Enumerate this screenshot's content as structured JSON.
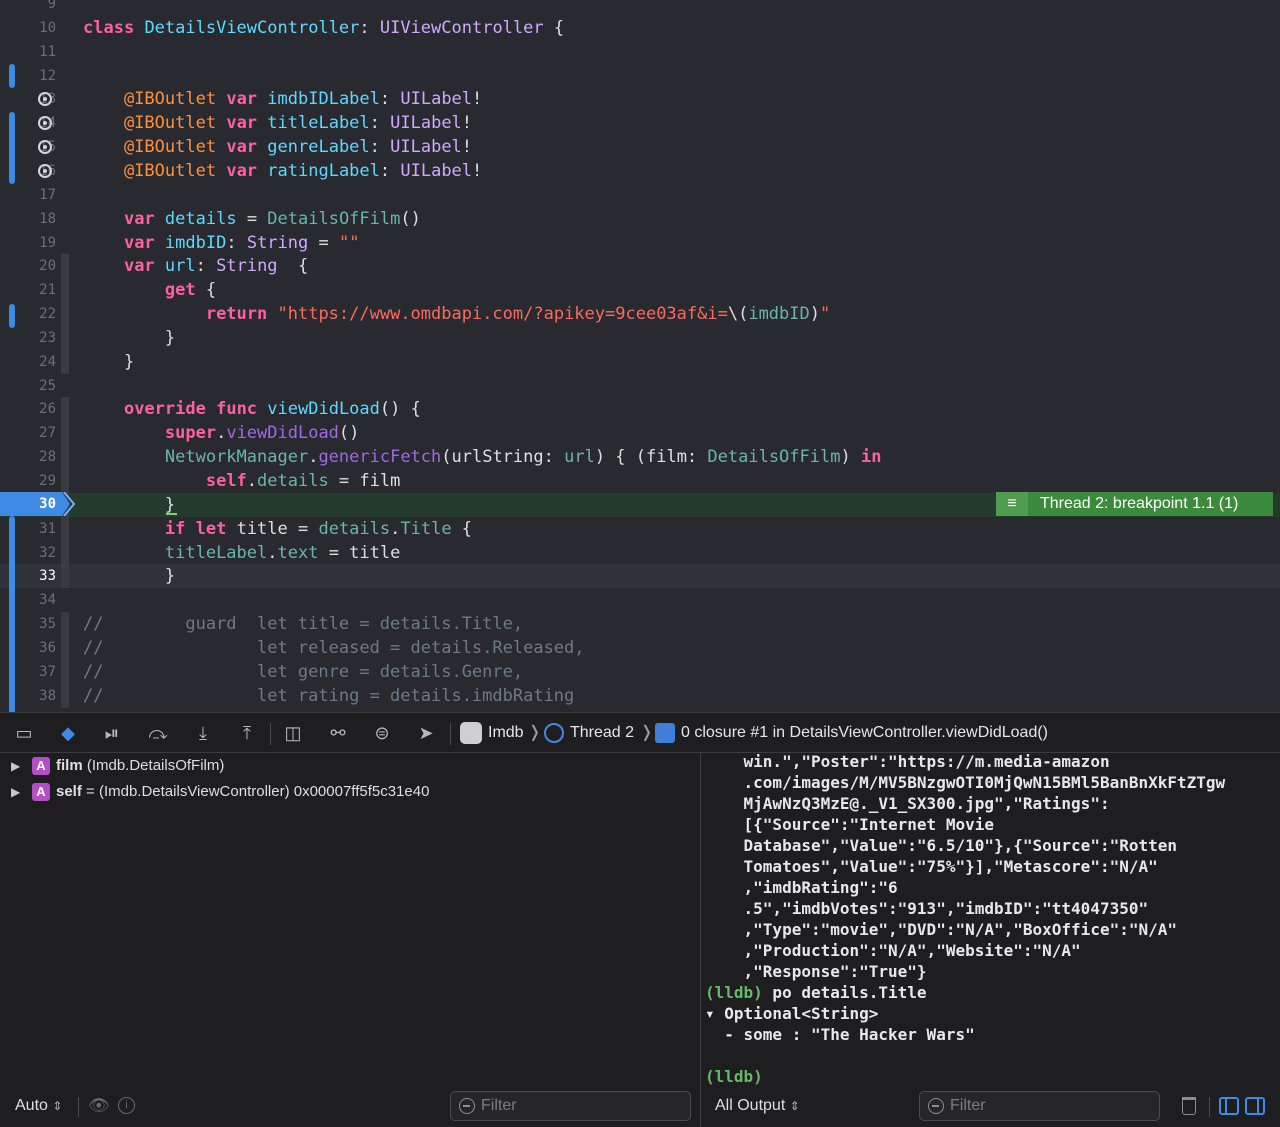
{
  "editor": {
    "lines": [
      {
        "num": "9",
        "tokens": []
      },
      {
        "num": "10",
        "tokens": [
          [
            "kw",
            "class"
          ],
          [
            "",
            " "
          ],
          [
            "tyd",
            "DetailsViewController"
          ],
          [
            "",
            ": "
          ],
          [
            "ty",
            "UIViewController"
          ],
          [
            "",
            " {"
          ]
        ]
      },
      {
        "num": "11",
        "tokens": []
      },
      {
        "num": "12",
        "tokens": []
      },
      {
        "num": "13",
        "tokens": [
          [
            "",
            "    "
          ],
          [
            "attr",
            "@IBOutlet"
          ],
          [
            "",
            " "
          ],
          [
            "kw",
            "var"
          ],
          [
            "",
            " "
          ],
          [
            "tyd",
            "imdbIDLabel"
          ],
          [
            "",
            ": "
          ],
          [
            "ty",
            "UILabel"
          ],
          [
            "",
            "!"
          ]
        ]
      },
      {
        "num": "14",
        "tokens": [
          [
            "",
            "    "
          ],
          [
            "attr",
            "@IBOutlet"
          ],
          [
            "",
            " "
          ],
          [
            "kw",
            "var"
          ],
          [
            "",
            " "
          ],
          [
            "tyd",
            "titleLabel"
          ],
          [
            "",
            ": "
          ],
          [
            "ty",
            "UILabel"
          ],
          [
            "",
            "!"
          ]
        ]
      },
      {
        "num": "15",
        "tokens": [
          [
            "",
            "    "
          ],
          [
            "attr",
            "@IBOutlet"
          ],
          [
            "",
            " "
          ],
          [
            "kw",
            "var"
          ],
          [
            "",
            " "
          ],
          [
            "tyd",
            "genreLabel"
          ],
          [
            "",
            ": "
          ],
          [
            "ty",
            "UILabel"
          ],
          [
            "",
            "!"
          ]
        ]
      },
      {
        "num": "16",
        "tokens": [
          [
            "",
            "    "
          ],
          [
            "attr",
            "@IBOutlet"
          ],
          [
            "",
            " "
          ],
          [
            "kw",
            "var"
          ],
          [
            "",
            " "
          ],
          [
            "tyd",
            "ratingLabel"
          ],
          [
            "",
            ": "
          ],
          [
            "ty",
            "UILabel"
          ],
          [
            "",
            "!"
          ]
        ]
      },
      {
        "num": "17",
        "tokens": []
      },
      {
        "num": "18",
        "tokens": [
          [
            "",
            "    "
          ],
          [
            "kw",
            "var"
          ],
          [
            "",
            " "
          ],
          [
            "tyd",
            "details"
          ],
          [
            "",
            " = "
          ],
          [
            "prop",
            "DetailsOfFilm"
          ],
          [
            "",
            "()"
          ]
        ]
      },
      {
        "num": "19",
        "tokens": [
          [
            "",
            "    "
          ],
          [
            "kw",
            "var"
          ],
          [
            "",
            " "
          ],
          [
            "tyd",
            "imdbID"
          ],
          [
            "",
            ": "
          ],
          [
            "ty",
            "String"
          ],
          [
            "",
            " = "
          ],
          [
            "str",
            "\"\""
          ]
        ]
      },
      {
        "num": "20",
        "tokens": [
          [
            "",
            "    "
          ],
          [
            "kw",
            "var"
          ],
          [
            "",
            " "
          ],
          [
            "tyd",
            "url"
          ],
          [
            "",
            ": "
          ],
          [
            "ty",
            "String"
          ],
          [
            "",
            "  {"
          ]
        ]
      },
      {
        "num": "21",
        "tokens": [
          [
            "",
            "        "
          ],
          [
            "kw",
            "get"
          ],
          [
            "",
            " {"
          ]
        ]
      },
      {
        "num": "22",
        "tokens": [
          [
            "",
            "            "
          ],
          [
            "kw",
            "return"
          ],
          [
            "",
            " "
          ],
          [
            "str",
            "\"https://www.omdbapi.com/?apikey=9cee03af&i="
          ],
          [
            "",
            "\\("
          ],
          [
            "prop",
            "imdbID"
          ],
          [
            "",
            ")"
          ],
          [
            "str",
            "\""
          ]
        ]
      },
      {
        "num": "23",
        "tokens": [
          [
            "",
            "        }"
          ]
        ]
      },
      {
        "num": "24",
        "tokens": [
          [
            "",
            "    }"
          ]
        ]
      },
      {
        "num": "25",
        "tokens": []
      },
      {
        "num": "26",
        "tokens": [
          [
            "",
            "    "
          ],
          [
            "kw",
            "override"
          ],
          [
            "",
            " "
          ],
          [
            "kw",
            "func"
          ],
          [
            "",
            " "
          ],
          [
            "tyd",
            "viewDidLoad"
          ],
          [
            "",
            "() {"
          ]
        ]
      },
      {
        "num": "27",
        "tokens": [
          [
            "",
            "        "
          ],
          [
            "kw",
            "super"
          ],
          [
            "",
            "."
          ],
          [
            "meth",
            "viewDidLoad"
          ],
          [
            "",
            "()"
          ]
        ]
      },
      {
        "num": "28",
        "tokens": [
          [
            "",
            "        "
          ],
          [
            "prop",
            "NetworkManager"
          ],
          [
            "",
            "."
          ],
          [
            "meth",
            "genericFetch"
          ],
          [
            "",
            "(urlString: "
          ],
          [
            "prop",
            "url"
          ],
          [
            "",
            ") { (film: "
          ],
          [
            "prop",
            "DetailsOfFilm"
          ],
          [
            "",
            ") "
          ],
          [
            "kw",
            "in"
          ]
        ]
      },
      {
        "num": "29",
        "tokens": [
          [
            "",
            "            "
          ],
          [
            "kw",
            "self"
          ],
          [
            "",
            "."
          ],
          [
            "prop",
            "details"
          ],
          [
            "",
            " = film"
          ]
        ]
      },
      {
        "num": "30",
        "tokens": [
          [
            "",
            "        }"
          ]
        ]
      },
      {
        "num": "31",
        "tokens": [
          [
            "",
            "        "
          ],
          [
            "kw",
            "if"
          ],
          [
            "",
            " "
          ],
          [
            "kw",
            "let"
          ],
          [
            "",
            " title = "
          ],
          [
            "prop",
            "details"
          ],
          [
            "",
            "."
          ],
          [
            "prop",
            "Title"
          ],
          [
            "",
            " {"
          ]
        ]
      },
      {
        "num": "32",
        "tokens": [
          [
            "",
            "        "
          ],
          [
            "prop",
            "titleLabel"
          ],
          [
            "",
            "."
          ],
          [
            "prop",
            "text"
          ],
          [
            "",
            " = title"
          ]
        ]
      },
      {
        "num": "33",
        "tokens": [
          [
            "",
            "        }"
          ]
        ]
      },
      {
        "num": "34",
        "tokens": []
      },
      {
        "num": "35",
        "tokens": [
          [
            "cmt",
            "//        guard  let title = details.Title,"
          ]
        ]
      },
      {
        "num": "36",
        "tokens": [
          [
            "cmt",
            "//               let released = details.Released,"
          ]
        ]
      },
      {
        "num": "37",
        "tokens": [
          [
            "cmt",
            "//               let genre = details.Genre,"
          ]
        ]
      },
      {
        "num": "38",
        "tokens": [
          [
            "cmt",
            "//               let rating = details.imdbRating"
          ]
        ]
      }
    ],
    "breakpoint_label": "Thread 2: breakpoint 1.1 (1)"
  },
  "debugbar": {
    "target": "Imdb",
    "thread": "Thread 2",
    "frame": "0 closure #1 in DetailsViewController.viewDidLoad()"
  },
  "variables": [
    {
      "name": "film",
      "detail": " (Imdb.DetailsOfFilm)"
    },
    {
      "name": "self",
      "detail": " = (Imdb.DetailsViewController) 0x00007ff5f5c31e40"
    }
  ],
  "variables_footer": {
    "scope": "Auto",
    "filter_placeholder": "Filter"
  },
  "console": {
    "lines": [
      {
        "cls": "",
        "text": "    win.\",\"Poster\":\"https://m.media-amazon"
      },
      {
        "cls": "",
        "text": "    .com/images/M/MV5BNzgwOTI0MjQwN15BMl5BanBnXkFtZTgw"
      },
      {
        "cls": "",
        "text": "    MjAwNzQ3MzE@._V1_SX300.jpg\",\"Ratings\":"
      },
      {
        "cls": "",
        "text": "    [{\"Source\":\"Internet Movie"
      },
      {
        "cls": "",
        "text": "    Database\",\"Value\":\"6.5/10\"},{\"Source\":\"Rotten"
      },
      {
        "cls": "",
        "text": "    Tomatoes\",\"Value\":\"75%\"}],\"Metascore\":\"N/A\""
      },
      {
        "cls": "",
        "text": "    ,\"imdbRating\":\"6"
      },
      {
        "cls": "",
        "text": "    .5\",\"imdbVotes\":\"913\",\"imdbID\":\"tt4047350\""
      },
      {
        "cls": "",
        "text": "    ,\"Type\":\"movie\",\"DVD\":\"N/A\",\"BoxOffice\":\"N/A\""
      },
      {
        "cls": "",
        "text": "    ,\"Production\":\"N/A\",\"Website\":\"N/A\""
      },
      {
        "cls": "",
        "text": "    ,\"Response\":\"True\"}"
      },
      {
        "cls": "cmd",
        "prompt": "(lldb)",
        "text": " po details.Title"
      },
      {
        "cls": "",
        "text": "▾ Optional<String>"
      },
      {
        "cls": "",
        "text": "  - some : \"The Hacker Wars\""
      },
      {
        "cls": "",
        "text": ""
      },
      {
        "cls": "cmd",
        "prompt": "(lldb)",
        "text": ""
      }
    ],
    "output_scope": "All Output",
    "filter_placeholder": "Filter"
  }
}
